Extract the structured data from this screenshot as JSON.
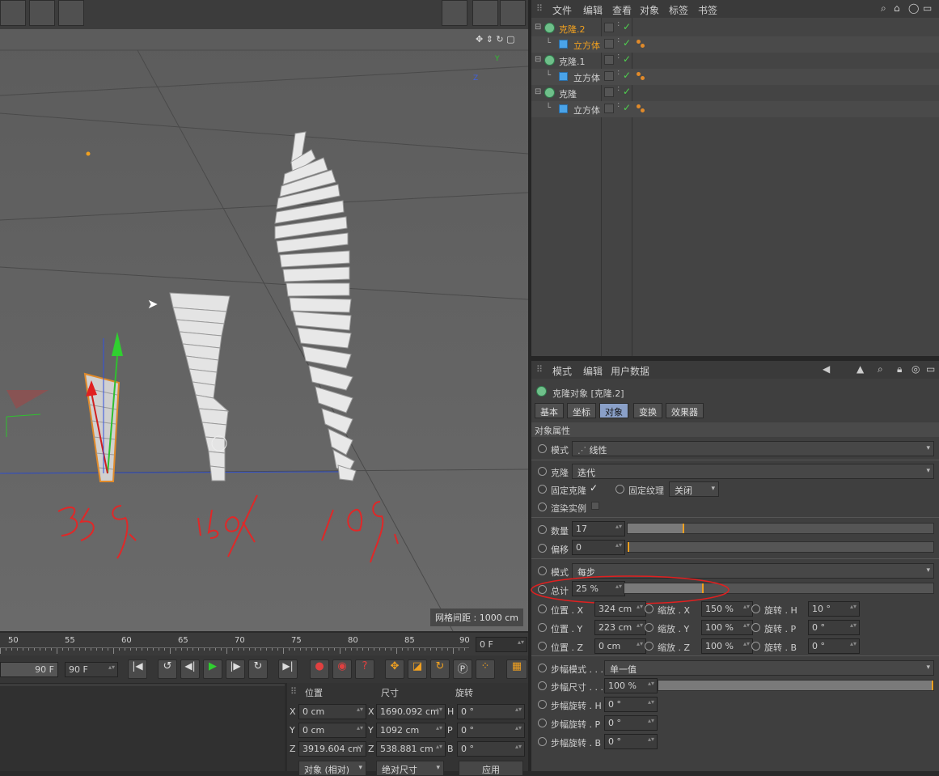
{
  "viewport": {
    "grid_info": "网格间距 : 1000 cm",
    "axis_labels": {
      "y": "Y",
      "z": "Z"
    },
    "annotations": [
      "25%",
      "50%",
      "100%"
    ]
  },
  "timeline": {
    "ticks": [
      "50",
      "55",
      "60",
      "65",
      "70",
      "75",
      "80",
      "85",
      "90"
    ],
    "current_frame": "0 F"
  },
  "playbar": {
    "end_frame_a": "90 F",
    "end_frame_b": "90 F"
  },
  "coord_manager": {
    "headers": {
      "position": "位置",
      "size": "尺寸",
      "rotation": "旋转"
    },
    "rows": [
      {
        "axis": "X",
        "pos": "0 cm",
        "size_axis": "X",
        "size": "1690.092 cm",
        "rot_axis": "H",
        "rot": "0 °"
      },
      {
        "axis": "Y",
        "pos": "0 cm",
        "size_axis": "Y",
        "size": "1092 cm",
        "rot_axis": "P",
        "rot": "0 °"
      },
      {
        "axis": "Z",
        "pos": "3919.604 cm",
        "size_axis": "Z",
        "size": "538.881 cm",
        "rot_axis": "B",
        "rot": "0 °"
      }
    ],
    "mode_a": "对象 (相对)",
    "mode_b": "绝对尺寸",
    "apply": "应用"
  },
  "object_manager": {
    "menu": [
      "文件",
      "编辑",
      "查看",
      "对象",
      "标签",
      "书签"
    ],
    "objects": [
      {
        "name": "克隆.2",
        "type": "cloner",
        "indent": 0,
        "selected": true
      },
      {
        "name": "立方体",
        "type": "cube",
        "indent": 1,
        "selected": true
      },
      {
        "name": "克隆.1",
        "type": "cloner",
        "indent": 0,
        "selected": false
      },
      {
        "name": "立方体",
        "type": "cube",
        "indent": 1,
        "selected": false
      },
      {
        "name": "克隆",
        "type": "cloner",
        "indent": 0,
        "selected": false
      },
      {
        "name": "立方体",
        "type": "cube",
        "indent": 1,
        "selected": false
      }
    ],
    "selected_color": "#f0a020"
  },
  "attribute_manager": {
    "menu": [
      "模式",
      "编辑",
      "用户数据"
    ],
    "title": "克隆对象 [克隆.2]",
    "tabs": [
      "基本",
      "坐标",
      "对象",
      "变换",
      "效果器"
    ],
    "active_tab": "对象",
    "section": "对象属性",
    "mode_label": "模式",
    "mode_value": "线性",
    "clone_label": "克隆",
    "clone_value": "迭代",
    "fix_clone_label": "固定克隆",
    "fix_texture_label": "固定纹理",
    "fix_texture_value": "关闭",
    "render_instances_label": "渲染实例",
    "count_label": "数量",
    "count_value": "17",
    "count_fraction": 0.18,
    "offset_label": "偏移",
    "offset_value": "0",
    "mode2_label": "模式",
    "mode2_value": "每步",
    "total_label": "总计",
    "total_value": "25 %",
    "total_fraction": 0.25,
    "pos": [
      {
        "label": "位置 . X",
        "value": "324 cm"
      },
      {
        "label": "位置 . Y",
        "value": "223 cm"
      },
      {
        "label": "位置 . Z",
        "value": "0 cm"
      }
    ],
    "scale": [
      {
        "label": "缩放 . X",
        "value": "150 %"
      },
      {
        "label": "缩放 . Y",
        "value": "100 %"
      },
      {
        "label": "缩放 . Z",
        "value": "100 %"
      }
    ],
    "rot": [
      {
        "label": "旋转 . H",
        "value": "10 °"
      },
      {
        "label": "旋转 . P",
        "value": "0 °"
      },
      {
        "label": "旋转 . B",
        "value": "0 °"
      }
    ],
    "step_mode_label": "步幅模式 . . .",
    "step_mode_value": "单一值",
    "step_size_label": "步幅尺寸 . . .",
    "step_size_value": "100 %",
    "step_size_fraction": 1.0,
    "step_rot": [
      {
        "label": "步幅旋转 . H",
        "value": "0 °"
      },
      {
        "label": "步幅旋转 . P",
        "value": "0 °"
      },
      {
        "label": "步幅旋转 . B",
        "value": "0 °"
      }
    ],
    "highlight_color": "#e02020"
  }
}
